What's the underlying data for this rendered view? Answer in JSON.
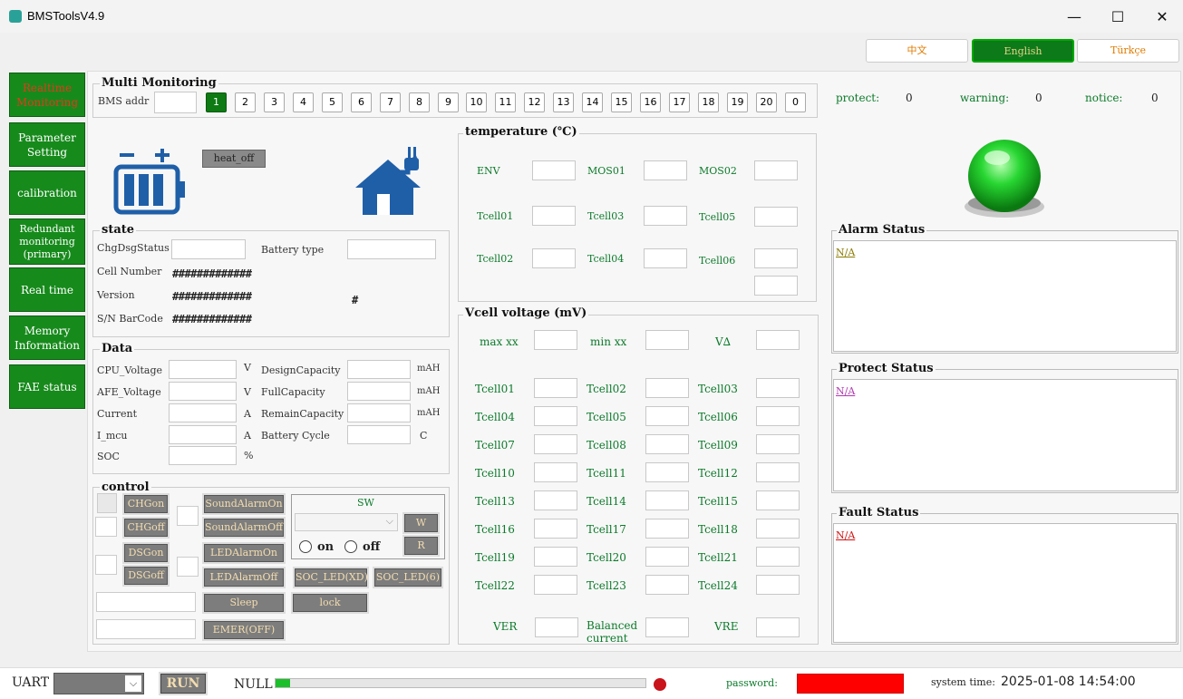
{
  "window": {
    "title": "BMSToolsV4.9",
    "minimize": "—",
    "maximize": "☐",
    "close": "✕"
  },
  "languages": [
    {
      "label": "中文"
    },
    {
      "label": "English"
    },
    {
      "label": "Türkçe"
    }
  ],
  "nav": [
    {
      "label": "Realtime Monitoring"
    },
    {
      "label": "Parameter Setting"
    },
    {
      "label": "calibration"
    },
    {
      "label": "Redundant monitoring (primary)"
    },
    {
      "label": "Real time"
    },
    {
      "label": "Memory Information"
    },
    {
      "label": "FAE status"
    }
  ],
  "multi": {
    "title": "Multi Monitoring",
    "addr_label": "BMS addr",
    "addr_value": "",
    "buttons": [
      "1",
      "2",
      "3",
      "4",
      "5",
      "6",
      "7",
      "8",
      "9",
      "10",
      "11",
      "12",
      "13",
      "14",
      "15",
      "16",
      "17",
      "18",
      "19",
      "20",
      "0"
    ]
  },
  "heat_label": "heat_off",
  "state": {
    "title": "state",
    "chg_label": "ChgDsgStatus",
    "type_label": "Battery type",
    "cell_label": "Cell Number",
    "cell_value": "#############",
    "version_label": "Version",
    "version_value": "#############",
    "version_extra": "#",
    "sn_label": "S/N BarCode",
    "sn_value": "#############"
  },
  "data": {
    "title": "Data",
    "left": [
      {
        "label": "CPU_Voltage",
        "unit": "V"
      },
      {
        "label": "AFE_Voltage",
        "unit": "V"
      },
      {
        "label": "Current",
        "unit": "A"
      },
      {
        "label": "I_mcu",
        "unit": "A"
      },
      {
        "label": "SOC",
        "unit": "%"
      }
    ],
    "right": [
      {
        "label": "DesignCapacity",
        "unit": "mAH"
      },
      {
        "label": "FullCapacity",
        "unit": "mAH"
      },
      {
        "label": "RemainCapacity",
        "unit": "mAH"
      },
      {
        "label": "Battery Cycle",
        "unit": "C"
      }
    ]
  },
  "control": {
    "title": "control",
    "chgon": "CHGon",
    "chgoff": "CHGoff",
    "dsgon": "DSGon",
    "dsgoff": "DSGoff",
    "sound_on": "SoundAlarmOn",
    "sound_off": "SoundAlarmOff",
    "led_on": "LEDAlarmOn",
    "led_off": "LEDAlarmOff",
    "soc_xd": "SOC_LED(XD)",
    "soc_6": "SOC_LED(6)",
    "sleep": "Sleep",
    "lock": "lock",
    "emer": "EMER(OFF)",
    "sw_title": "SW",
    "w": "W",
    "r": "R",
    "on": "on",
    "off": "off"
  },
  "temperature": {
    "title": "temperature (℃)",
    "labels": [
      "ENV",
      "MOS01",
      "MOS02",
      "Tcell01",
      "Tcell03",
      "Tcell05",
      "Tcell02",
      "Tcell04",
      "Tcell06"
    ]
  },
  "vcell": {
    "title": "Vcell voltage (mV)",
    "max": "max xx",
    "min": "min xx",
    "delta": "V∆",
    "cells": [
      "Tcell01",
      "Tcell02",
      "Tcell03",
      "Tcell04",
      "Tcell05",
      "Tcell06",
      "Tcell07",
      "Tcell08",
      "Tcell09",
      "Tcell10",
      "Tcell11",
      "Tcell12",
      "Tcell13",
      "Tcell14",
      "Tcell15",
      "Tcell16",
      "Tcell17",
      "Tcell18",
      "Tcell19",
      "Tcell20",
      "Tcell21",
      "Tcell22",
      "Tcell23",
      "Tcell24"
    ],
    "ver": "VER",
    "balanced": "Balanced current",
    "vre": "VRE"
  },
  "counts": {
    "protect_label": "protect:",
    "protect": "0",
    "warning_label": "warning:",
    "warning": "0",
    "notice_label": "notice:",
    "notice": "0"
  },
  "alarm": {
    "title": "Alarm Status",
    "value": "N/A"
  },
  "protect": {
    "title": "Protect Status",
    "value": "N/A"
  },
  "fault": {
    "title": "Fault Status",
    "value": "N/A"
  },
  "bottom": {
    "uart": "UART",
    "run": "RUN",
    "null": "NULL",
    "progress": 0.04,
    "password_label": "password:",
    "system_time_label": "system time:",
    "system_time": "2025-01-08 14:54:00"
  },
  "colors": {
    "nav_green": "#178a1c",
    "alarm_na": "#8a7a00",
    "protect_na": "#b03ab0",
    "fault_na": "#d01010",
    "password_red": "#ff0000"
  }
}
